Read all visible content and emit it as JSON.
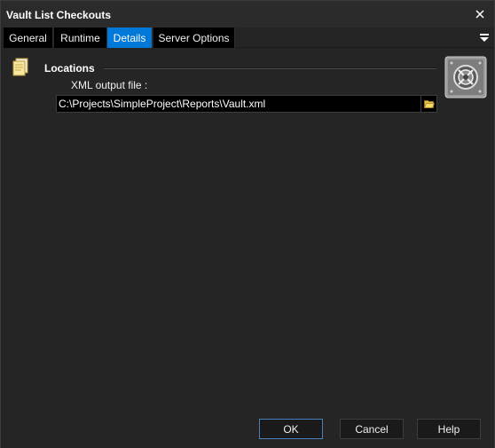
{
  "window": {
    "title": "Vault List Checkouts"
  },
  "tabs": [
    {
      "label": "General",
      "active": false
    },
    {
      "label": "Runtime",
      "active": false
    },
    {
      "label": "Details",
      "active": true
    },
    {
      "label": "Server Options",
      "active": false
    }
  ],
  "section": {
    "title": "Locations"
  },
  "xml_output": {
    "label": "XML output file :",
    "value": "C:\\Projects\\SimpleProject\\Reports\\Vault.xml"
  },
  "buttons": {
    "ok": "OK",
    "cancel": "Cancel",
    "help": "Help"
  },
  "colors": {
    "accent": "#0078d7",
    "background": "#252525"
  },
  "icons": {
    "close": "close-icon",
    "tab_menu": "menu-icon",
    "section": "folder-icon",
    "vault": "vault-icon",
    "browse": "folder-open-icon"
  }
}
